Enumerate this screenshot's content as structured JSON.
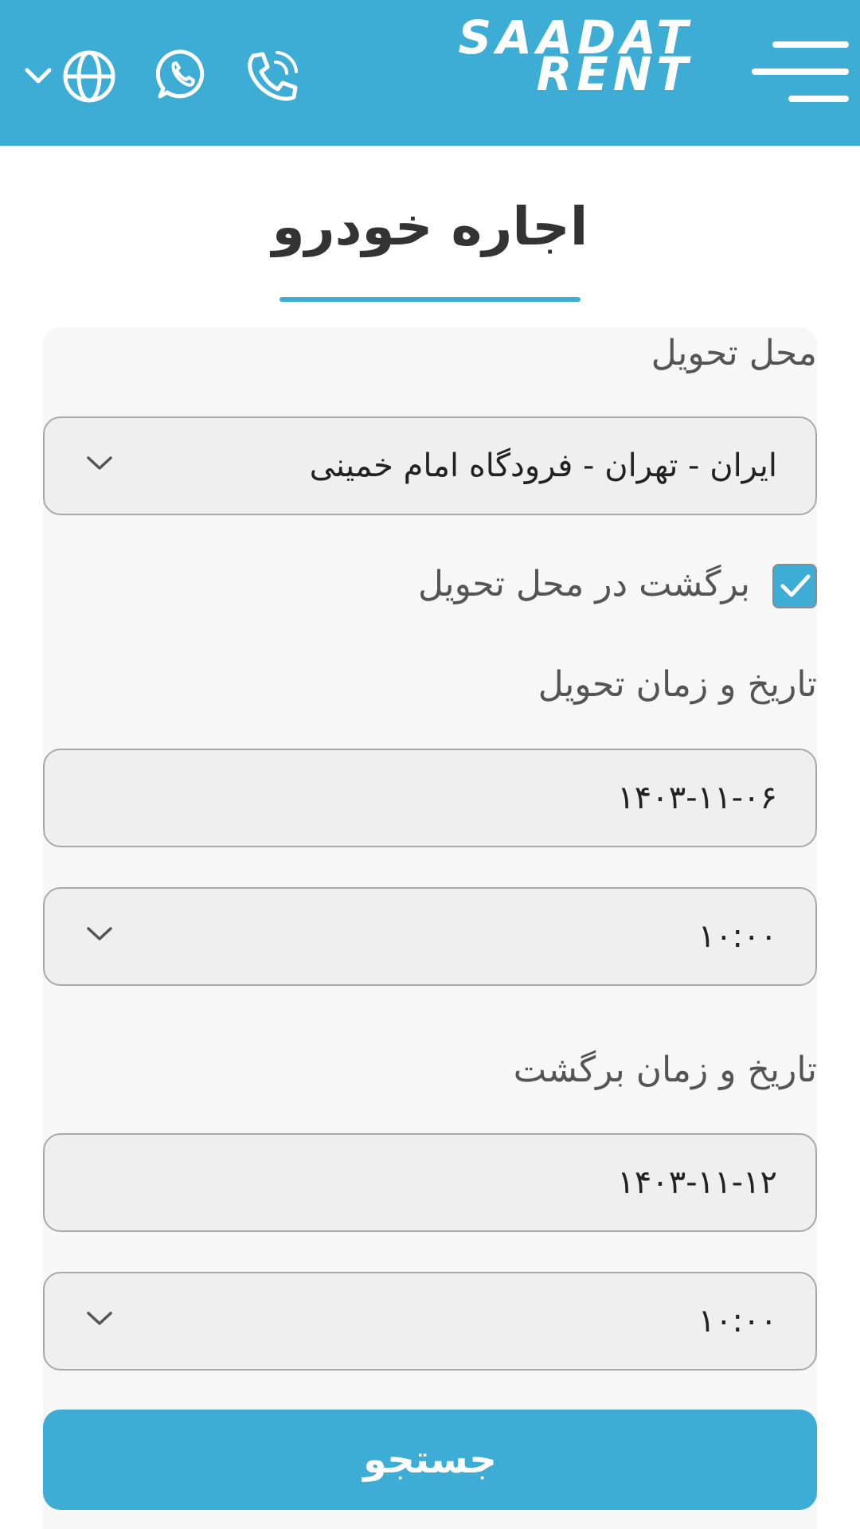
{
  "header": {
    "brand_line1": "SAADAT",
    "brand_line2": "RENT",
    "icons": [
      "menu-icon",
      "phone-icon",
      "whatsapp-icon",
      "globe-icon",
      "chevron-down-icon"
    ],
    "background_color": "#3dadd6"
  },
  "page": {
    "title": "اجاره خودرو",
    "accent_color": "#3dadd6"
  },
  "form": {
    "pickup_location_label": "محل تحویل",
    "pickup_location_value": "ایران - تهران - فرودگاه امام خمینی",
    "return_same_place_label": "برگشت در محل تحویل",
    "return_same_place_checked": true,
    "pickup_datetime_label": "تاریخ و زمان تحویل",
    "pickup_date": "۱۴۰۳-۱۱-۰۶",
    "pickup_time": "۱۰:۰۰",
    "return_datetime_label": "تاریخ و زمان برگشت",
    "return_date": "۱۴۰۳-۱۱-۱۲",
    "return_time": "۱۰:۰۰",
    "search_button": "جستجو"
  }
}
